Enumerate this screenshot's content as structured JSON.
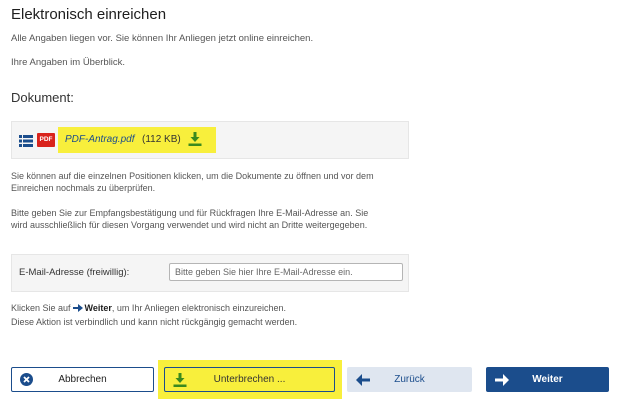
{
  "title": "Elektronisch einreichen",
  "intro": {
    "line1": "Alle Angaben liegen vor. Sie können Ihr Anliegen jetzt online einreichen.",
    "line2": "Ihre Angaben im Überblick."
  },
  "document_section": {
    "heading": "Dokument:",
    "file_name": "PDF-Antrag.pdf",
    "file_size": "(112 KB)",
    "pdf_badge": "PDF"
  },
  "hint_paragraphs": {
    "open_docs_1": "Sie können auf die einzelnen Positionen klicken, um die Dokumente zu öffnen und vor dem",
    "open_docs_2": "Einreichen nochmals zu überprüfen.",
    "email_info_1": "Bitte geben Sie zur Empfangsbestätigung und für Rückfragen Ihre E-Mail-Adresse an. Sie",
    "email_info_2": "wird ausschließlich für diesen Vorgang verwendet und wird nicht an Dritte weitergegeben."
  },
  "email": {
    "label": "E-Mail-Adresse (freiwillig):",
    "value": "",
    "placeholder": "Bitte geben Sie hier Ihre E-Mail-Adresse ein."
  },
  "submit_info": {
    "prefix": "Klicken Sie auf",
    "keyword": "Weiter",
    "suffix": ", um Ihr Anliegen elektronisch einzureichen.",
    "line2": "Diese Aktion ist verbindlich und kann nicht rückgängig gemacht werden."
  },
  "buttons": {
    "cancel": "Abbrechen",
    "interrupt": "Unterbrechen ...",
    "back": "Zurück",
    "next": "Weiter"
  },
  "colors": {
    "primary": "#1b4d8c",
    "highlight": "#f8ef3c",
    "pdf_red": "#d9231c",
    "download_green": "#3a8a1e"
  },
  "icons": {
    "list": "list-icon",
    "pdf": "pdf-icon",
    "download": "download-icon",
    "cancel": "close-circle-icon",
    "interrupt": "download-icon",
    "back": "arrow-left-icon",
    "next": "arrow-right-icon"
  }
}
